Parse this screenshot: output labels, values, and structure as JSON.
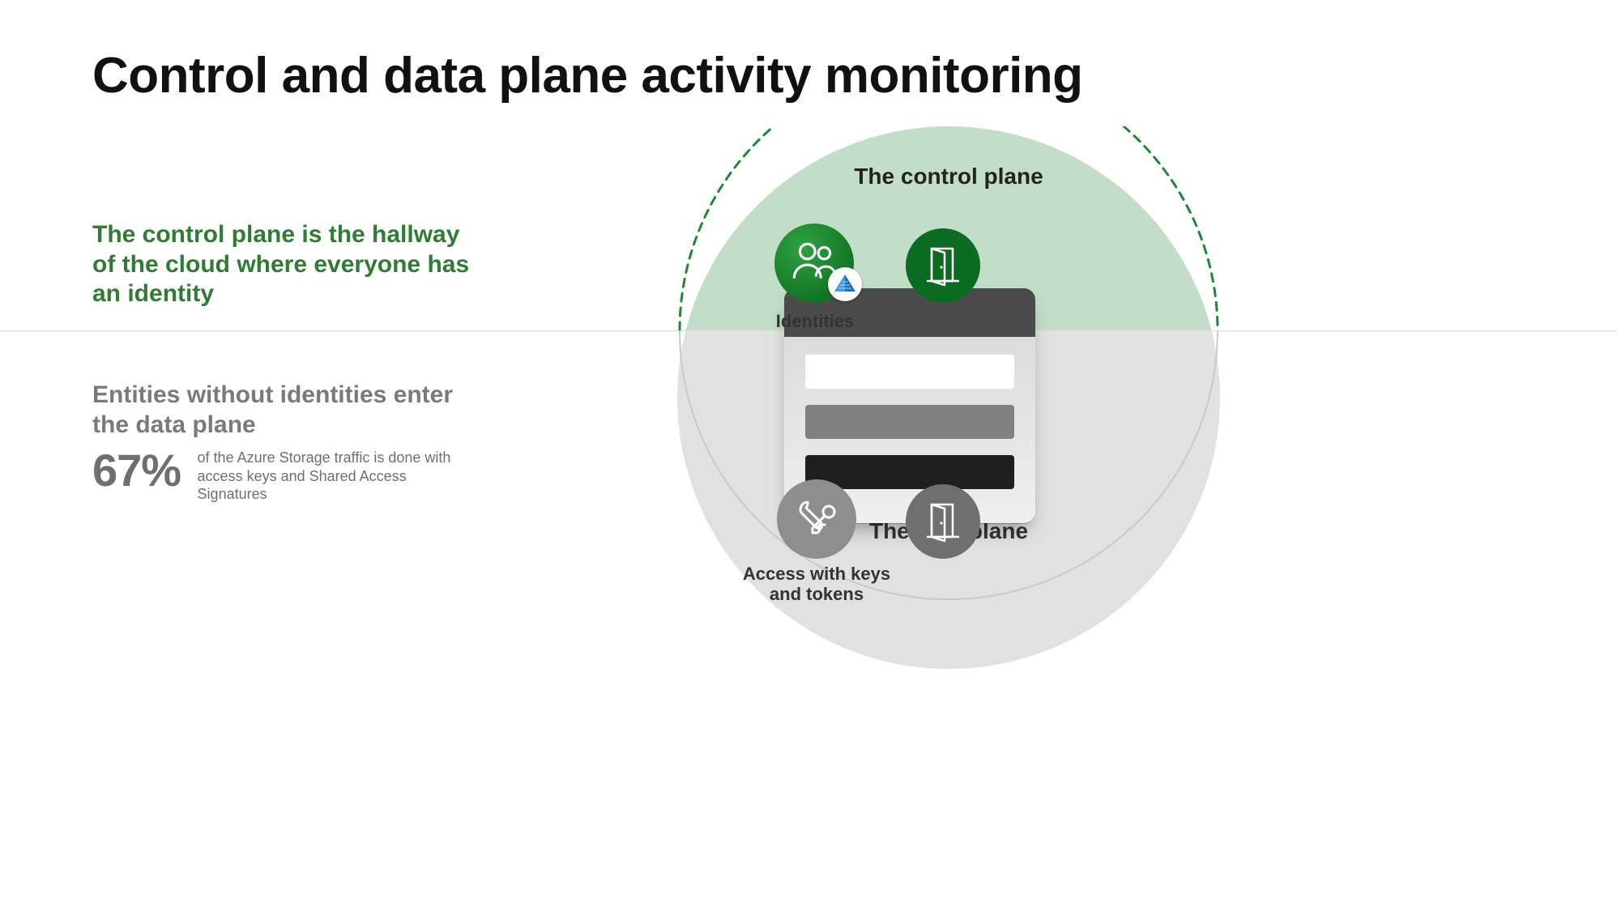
{
  "title": "Control and data plane activity monitoring",
  "left": {
    "control_plane_copy": "The control plane is the hallway of the cloud where everyone has an identity",
    "data_plane_copy": "Entities without identities enter the data plane",
    "stat_pct": "67%",
    "stat_desc": "of the Azure Storage traffic is done with access keys and Shared Access Signatures"
  },
  "diagram": {
    "control_plane_label": "The control plane",
    "data_plane_label": "The data plane",
    "identities_label": "Identities",
    "keys_label": "Access with keys and tokens"
  },
  "icons": {
    "identities": "people-icon",
    "azure_ad_badge": "azure-ad-icon",
    "door_control": "door-icon",
    "door_data": "door-icon",
    "keys": "key-wrench-icon"
  },
  "colors": {
    "green": "#1e8a2f",
    "light_green": "#c3dec8",
    "grey_pane": "#e1e1e1",
    "muted": "#7a7a7a"
  }
}
